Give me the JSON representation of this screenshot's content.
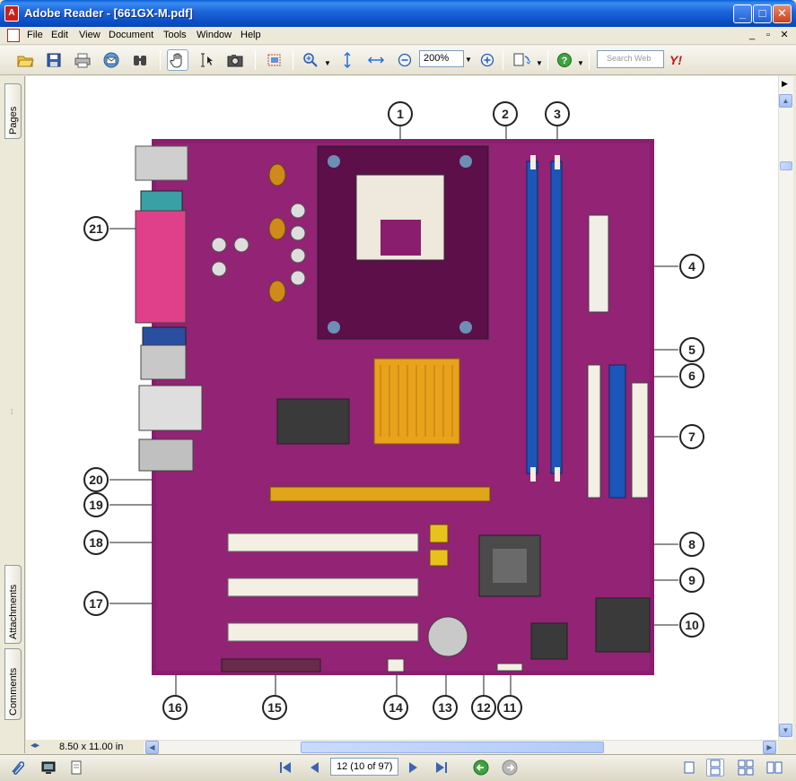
{
  "window": {
    "title": "Adobe Reader - [661GX-M.pdf]",
    "controls": {
      "minimize": "_",
      "maximize": "□",
      "close": "✕"
    }
  },
  "menubar": {
    "items": [
      "File",
      "Edit",
      "View",
      "Document",
      "Tools",
      "Window",
      "Help"
    ],
    "mdi": {
      "minimize": "_",
      "restore": "▫",
      "close": "✕"
    }
  },
  "toolbar": {
    "zoom_value": "200%",
    "search_placeholder": "Search Web",
    "yahoo_label": "Y!",
    "icons": [
      "open-icon",
      "save-icon",
      "print-icon",
      "email-icon",
      "find-icon",
      "hand-tool-icon",
      "select-text-icon",
      "snapshot-icon",
      "crop-icon",
      "zoom-in-tool-icon",
      "actual-size-icon",
      "fit-width-icon",
      "zoom-out-icon",
      "zoom-in-icon",
      "rotate-icon",
      "help-icon"
    ]
  },
  "sidepanel": {
    "tabs": [
      "Pages",
      "Attachments",
      "Comments"
    ]
  },
  "status": {
    "page_size": "8.50 x 11.00 in"
  },
  "navigation": {
    "page_display": "12  (10 of 97)"
  },
  "figure": {
    "callouts": [
      "1",
      "2",
      "3",
      "4",
      "5",
      "6",
      "7",
      "8",
      "9",
      "10",
      "11",
      "12",
      "13",
      "14",
      "15",
      "16",
      "17",
      "18",
      "19",
      "20",
      "21"
    ]
  },
  "colors": {
    "board": "#8b1d6e",
    "title_bar": "#0b4fc6",
    "dimm_slot": "#1c56b8",
    "agp_slot": "#e0a418",
    "pci_slot": "#f3efe3",
    "heatsink": "#e8a21c"
  }
}
